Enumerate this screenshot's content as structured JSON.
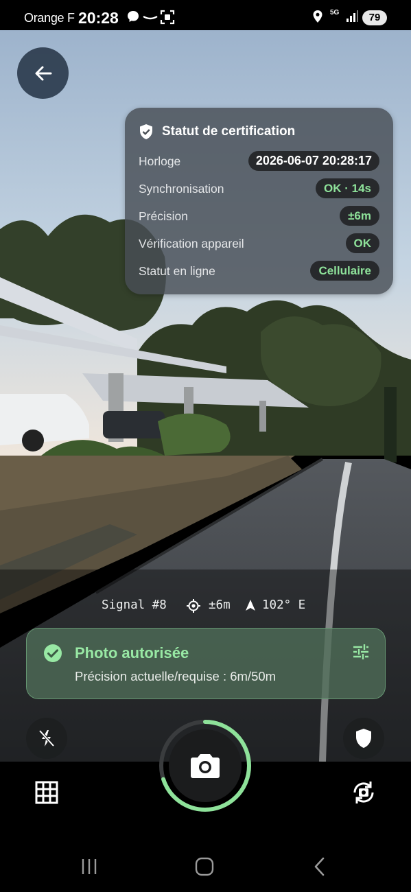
{
  "status_bar": {
    "carrier": "Orange F",
    "time": "20:28",
    "network": "5G",
    "battery": "79",
    "icons": [
      "messenger-icon",
      "voicemail-icon",
      "screenshot-icon",
      "location-icon",
      "signal-icon"
    ]
  },
  "certification": {
    "title": "Statut de certification",
    "rows": [
      {
        "label": "Horloge",
        "value": "2026-06-07 20:28:17"
      },
      {
        "label": "Synchronisation",
        "value": "OK · 14s"
      },
      {
        "label": "Précision",
        "value": "±6m"
      },
      {
        "label": "Vérification appareil",
        "value": "OK"
      },
      {
        "label": "Statut en ligne",
        "value": "Cellulaire"
      }
    ]
  },
  "signal": {
    "id": "Signal #8",
    "accuracy": "±6m",
    "heading": "102° E"
  },
  "authorization": {
    "title": "Photo autorisée",
    "subtitle": "Précision actuelle/requise : 6m/50m"
  },
  "shutter": {
    "progress": 0.7
  },
  "colors": {
    "accent_green": "#8ee29a",
    "card_dark": "#27292c",
    "back_button": "#2c3c4e"
  }
}
